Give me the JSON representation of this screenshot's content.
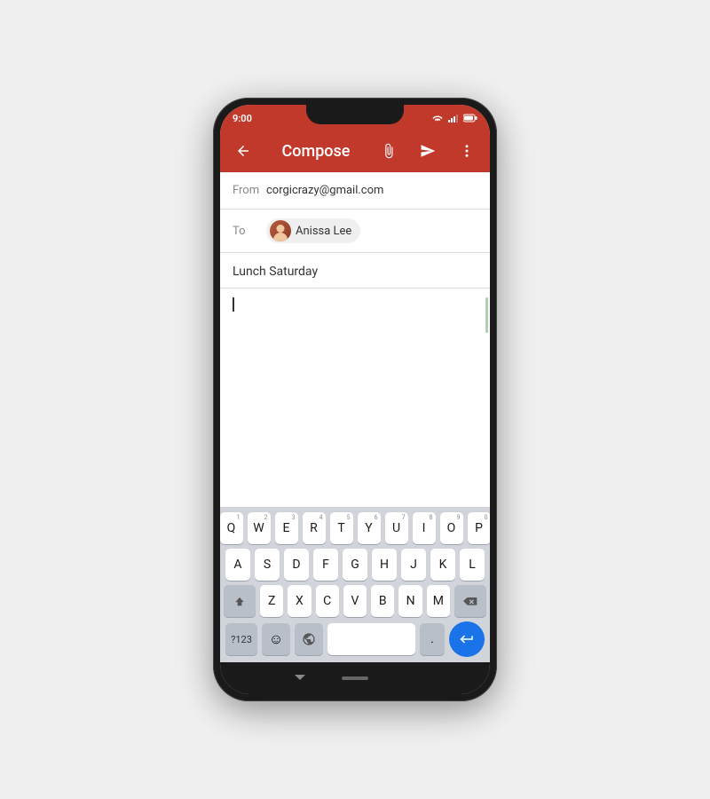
{
  "statusBar": {
    "time": "9:00"
  },
  "appBar": {
    "title": "Compose",
    "backLabel": "←",
    "attachIcon": "📎",
    "sendIcon": "▶",
    "moreIcon": "⋮"
  },
  "emailForm": {
    "fromLabel": "From",
    "fromAddress": "corgicrazy@gmail.com",
    "toLabel": "To",
    "recipientName": "Anissa Lee",
    "subjectText": "Lunch Saturday"
  },
  "keyboard": {
    "row1": [
      {
        "key": "Q",
        "num": "1"
      },
      {
        "key": "W",
        "num": "2"
      },
      {
        "key": "E",
        "num": "3"
      },
      {
        "key": "R",
        "num": "4"
      },
      {
        "key": "T",
        "num": "5"
      },
      {
        "key": "Y",
        "num": "6"
      },
      {
        "key": "U",
        "num": "7"
      },
      {
        "key": "I",
        "num": "8"
      },
      {
        "key": "O",
        "num": "9"
      },
      {
        "key": "P",
        "num": "0"
      }
    ],
    "row2": [
      {
        "key": "A"
      },
      {
        "key": "S"
      },
      {
        "key": "D"
      },
      {
        "key": "F"
      },
      {
        "key": "G"
      },
      {
        "key": "H"
      },
      {
        "key": "J"
      },
      {
        "key": "K"
      },
      {
        "key": "L"
      }
    ],
    "row3": [
      {
        "key": "Z"
      },
      {
        "key": "X"
      },
      {
        "key": "C"
      },
      {
        "key": "V"
      },
      {
        "key": "B"
      },
      {
        "key": "N"
      },
      {
        "key": "M"
      }
    ],
    "bottomRow": {
      "numLabel": "?123",
      "periodLabel": ".",
      "enterLabel": "↵"
    }
  }
}
